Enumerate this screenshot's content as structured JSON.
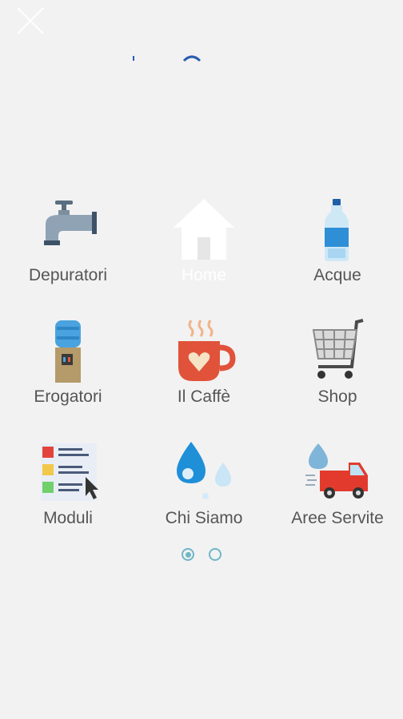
{
  "menu": {
    "items": [
      {
        "label": "Depuratori",
        "icon": "faucet-icon"
      },
      {
        "label": "Home",
        "icon": "house-icon",
        "active": true
      },
      {
        "label": "Acque",
        "icon": "water-bottle-icon"
      },
      {
        "label": "Erogatori",
        "icon": "water-cooler-icon"
      },
      {
        "label": "Il Caffè",
        "icon": "coffee-cup-icon"
      },
      {
        "label": "Shop",
        "icon": "shopping-cart-icon"
      },
      {
        "label": "Moduli",
        "icon": "forms-checklist-icon"
      },
      {
        "label": "Chi Siamo",
        "icon": "water-drops-icon"
      },
      {
        "label": "Aree Servite",
        "icon": "delivery-truck-icon"
      }
    ]
  },
  "pager": {
    "pages": 2,
    "current": 1
  },
  "colors": {
    "background": "#f2f2f2",
    "label": "#555555",
    "active_label": "#ffffff",
    "accent": "#6fb6c6"
  }
}
